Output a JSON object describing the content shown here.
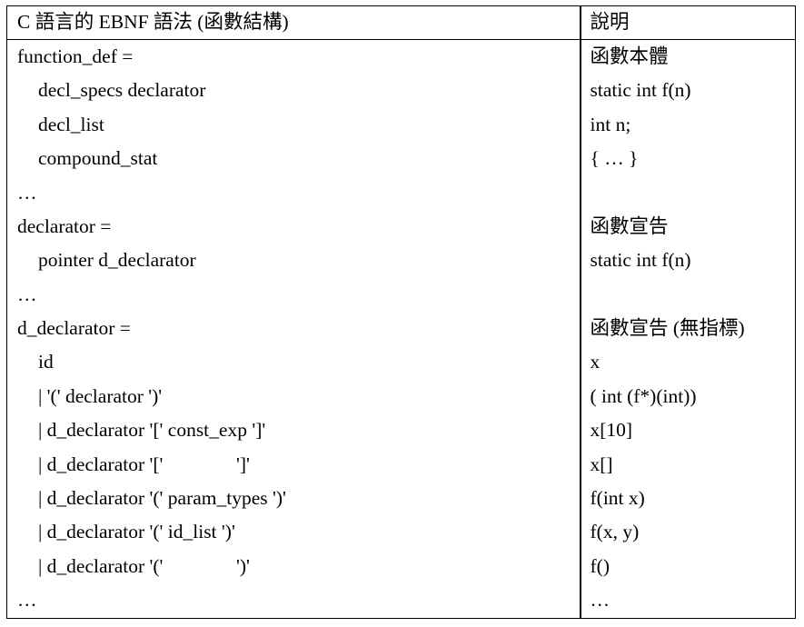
{
  "table": {
    "headers": {
      "grammar": "C 語言的 EBNF 語法 (函數結構)",
      "description": "說明"
    },
    "rows": [
      {
        "grammar": "function_def =",
        "description": "函數本體",
        "indent": 0
      },
      {
        "grammar": "decl_specs declarator",
        "description": "static int f(n)",
        "indent": 1
      },
      {
        "grammar": "decl_list",
        "description": "int n;",
        "indent": 1
      },
      {
        "grammar": "compound_stat",
        "description": "{ … }",
        "indent": 1
      },
      {
        "grammar": "…",
        "description": "",
        "indent": 0
      },
      {
        "grammar": "declarator =",
        "description": "函數宣告",
        "indent": 0
      },
      {
        "grammar": "pointer d_declarator",
        "description": "static int f(n)",
        "indent": 1
      },
      {
        "grammar": "…",
        "description": "",
        "indent": 0
      },
      {
        "grammar": "d_declarator =",
        "description": "函數宣告 (無指標)",
        "indent": 0
      },
      {
        "grammar": "id",
        "description": "x",
        "indent": 1
      },
      {
        "grammar": "| '(' declarator ')'",
        "description": "( int (f*)(int))",
        "indent": 1
      },
      {
        "grammar": "| d_declarator '[' const_exp ']'",
        "description": "x[10]",
        "indent": 1
      },
      {
        "grammar": "| d_declarator '['               ']'",
        "description": "x[]",
        "indent": 1
      },
      {
        "grammar": "| d_declarator '(' param_types ')'",
        "description": "f(int x)",
        "indent": 1
      },
      {
        "grammar": "| d_declarator '(' id_list ')'",
        "description": "f(x, y)",
        "indent": 1
      },
      {
        "grammar": "| d_declarator '('               ')'",
        "description": "f()",
        "indent": 1
      },
      {
        "grammar": "…",
        "description": "…",
        "indent": 0
      }
    ]
  }
}
